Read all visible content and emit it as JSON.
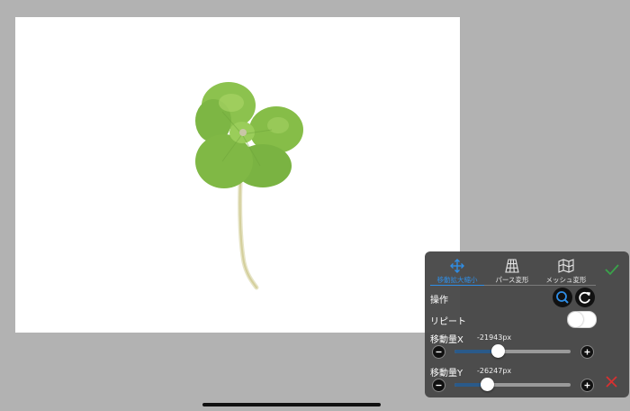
{
  "canvas": {
    "subject_icon": "four-leaf-clover-image"
  },
  "tabs": [
    {
      "label": "移動拡大縮小",
      "icon": "move-arrows-icon",
      "active": true
    },
    {
      "label": "パース変形",
      "icon": "perspective-grid-icon",
      "active": false
    },
    {
      "label": "メッシュ変形",
      "icon": "mesh-map-icon",
      "active": false
    }
  ],
  "operation": {
    "label": "操作",
    "buttons": [
      {
        "icon": "zoom-icon"
      },
      {
        "icon": "rotate-icon"
      }
    ]
  },
  "repeat": {
    "label": "リピート",
    "on": false
  },
  "move_x": {
    "label": "移動量X",
    "value": "-21943px",
    "slider_fraction": 0.37
  },
  "move_y": {
    "label": "移動量Y",
    "value": "-26247px",
    "slider_fraction": 0.28
  },
  "colors": {
    "accent": "#2f8ee6",
    "confirm": "#3aa34a",
    "cancel": "#d93030",
    "panel": "#484848",
    "track_fill": "#2a5a8a"
  }
}
